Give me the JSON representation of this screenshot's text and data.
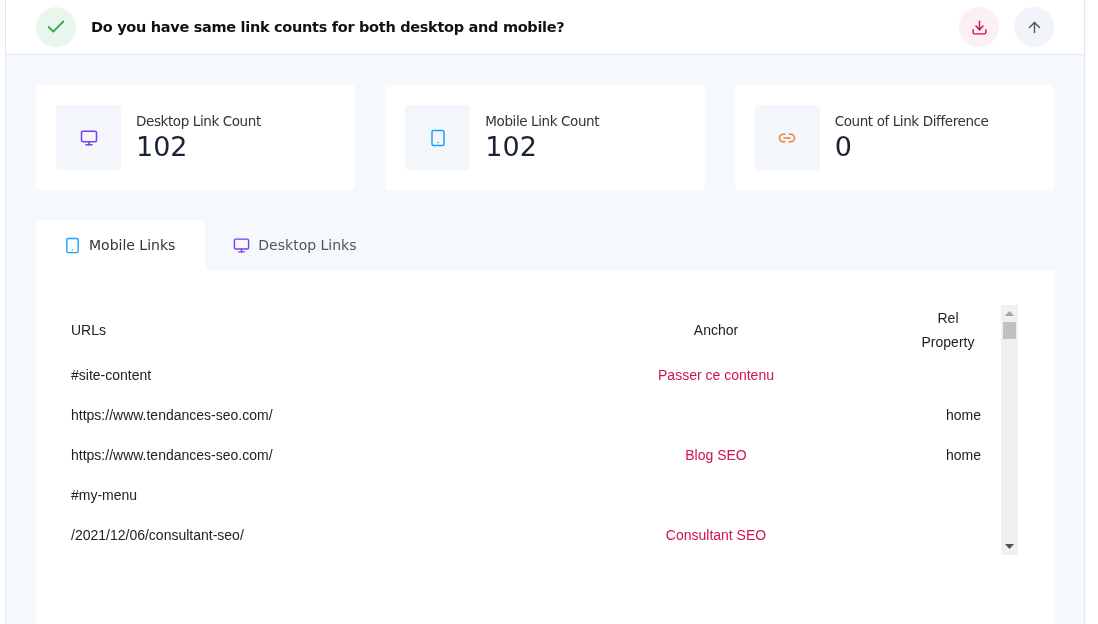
{
  "header": {
    "passed": true,
    "title": "Do you have same link counts for both desktop and mobile?"
  },
  "stats": [
    {
      "kind": "desktop",
      "label": "Desktop Link Count",
      "value": "102"
    },
    {
      "kind": "mobile",
      "label": "Mobile Link Count",
      "value": "102"
    },
    {
      "kind": "link",
      "label": "Count of Link Difference",
      "value": "0"
    }
  ],
  "tabs": [
    {
      "kind": "mobile",
      "label": "Mobile Links",
      "selected": true
    },
    {
      "kind": "desktop",
      "label": "Desktop Links",
      "selected": false
    }
  ],
  "table": {
    "columns": [
      "URLs",
      "Anchor",
      "Rel Property"
    ],
    "rows": [
      {
        "url": "#site-content",
        "anchor": "Passer ce contenu",
        "rel": ""
      },
      {
        "url": "https://www.tendances-seo.com/",
        "anchor": "",
        "rel": "home"
      },
      {
        "url": "https://www.tendances-seo.com/",
        "anchor": "Blog SEO",
        "rel": "home"
      },
      {
        "url": "#my-menu",
        "anchor": "",
        "rel": ""
      },
      {
        "url": "/2021/12/06/consultant-seo/",
        "anchor": "Consultant SEO",
        "rel": ""
      }
    ]
  }
}
